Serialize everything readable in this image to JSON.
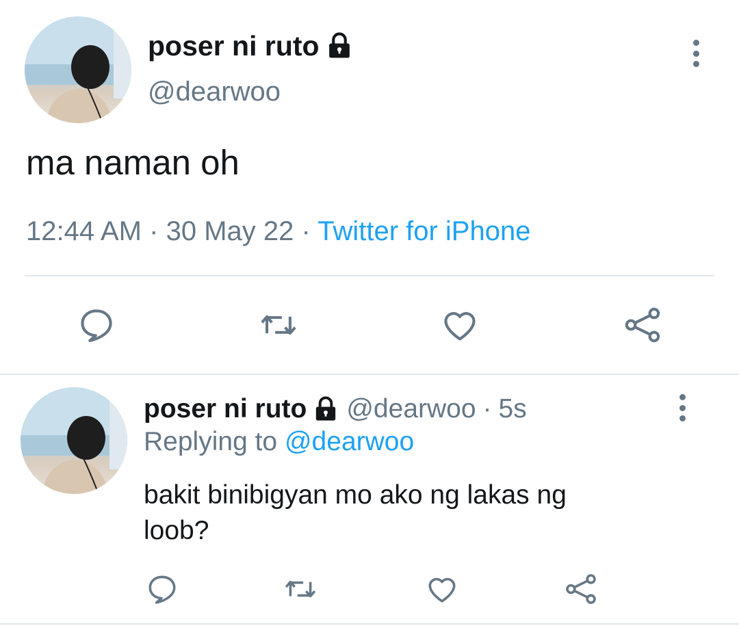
{
  "main_tweet": {
    "display_name": "poser ni ruto",
    "handle": "@dearwoo",
    "text": "ma naman oh",
    "time": "12:44 AM",
    "sep1": "·",
    "date": "30 May 22",
    "sep2": "·",
    "source": "Twitter for iPhone"
  },
  "reply_tweet": {
    "display_name": "poser ni ruto",
    "handle": "@dearwoo",
    "sep": "·",
    "age": "5s",
    "replying_label": "Replying to",
    "replying_to": "@dearwoo",
    "text_line1": "bakit binibigyan mo ako ng lakas ng",
    "text_line2": "loob?"
  },
  "icons": [
    "lock-icon",
    "more-options-icon",
    "reply-icon",
    "retweet-icon",
    "like-icon",
    "share-icon"
  ],
  "colors": {
    "text_primary": "#14171a",
    "text_secondary": "#657786",
    "link": "#1da1f2",
    "divider": "#e1e8ed"
  }
}
